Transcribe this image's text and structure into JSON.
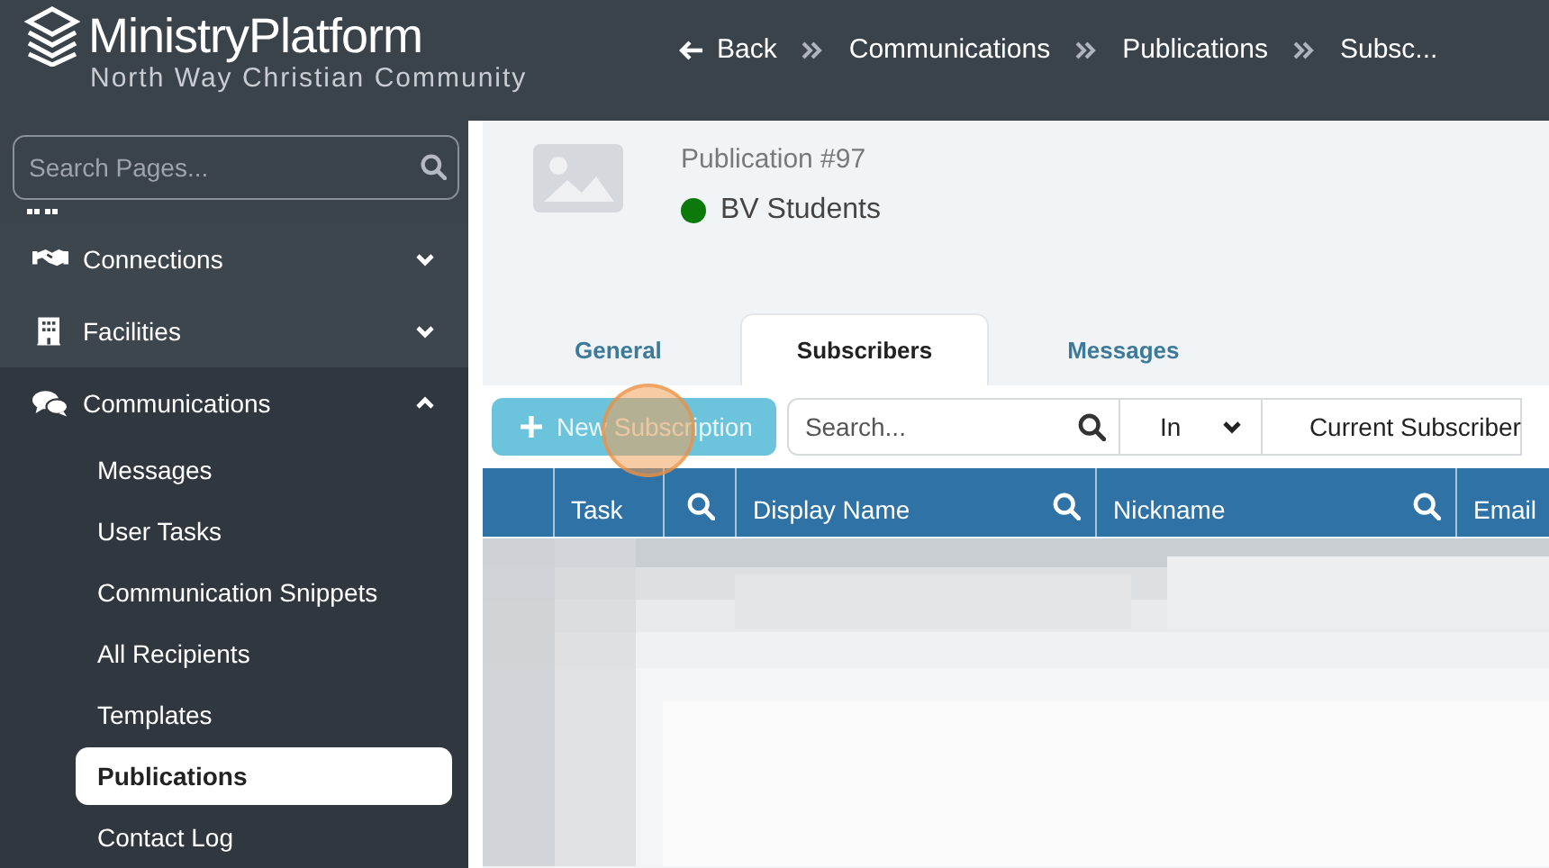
{
  "header": {
    "logo": "MinistryPlatform",
    "subtitle": "North Way Christian Community",
    "breadcrumbs": [
      {
        "label": "Back",
        "kind": "back"
      },
      {
        "label": "Communications",
        "kind": "crumb"
      },
      {
        "label": "Publications",
        "kind": "crumb"
      },
      {
        "label": "Subsc...",
        "kind": "crumb"
      }
    ]
  },
  "sidebar": {
    "search": {
      "placeholder": "Search Pages..."
    },
    "nav": [
      {
        "label": "Connections",
        "expanded": false
      },
      {
        "label": "Facilities",
        "expanded": false
      },
      {
        "label": "Communications",
        "expanded": true,
        "children": [
          {
            "label": "Messages",
            "selected": false
          },
          {
            "label": "User Tasks",
            "selected": false
          },
          {
            "label": "Communication Snippets",
            "selected": false
          },
          {
            "label": "All Recipients",
            "selected": false
          },
          {
            "label": "Templates",
            "selected": false
          },
          {
            "label": "Publications",
            "selected": true
          },
          {
            "label": "Contact Log",
            "selected": false
          }
        ]
      }
    ]
  },
  "record": {
    "label": "Publication #97",
    "name": "BV Students",
    "color": "#0b7a0b"
  },
  "tabs": [
    {
      "label": "General",
      "selected": false
    },
    {
      "label": "Subscribers",
      "selected": true
    },
    {
      "label": "Messages",
      "selected": false
    }
  ],
  "toolbar": {
    "new_button": "New Subscription",
    "search": {
      "placeholder": "Search..."
    },
    "operator": "In",
    "filter": "Current Subscriber"
  },
  "table": {
    "columns": [
      {
        "kind": "blank"
      },
      {
        "kind": "text",
        "label": "Task"
      },
      {
        "kind": "search"
      },
      {
        "kind": "text",
        "label": "Display Name",
        "searchable": true
      },
      {
        "kind": "text",
        "label": "Nickname",
        "searchable": true
      },
      {
        "kind": "text",
        "label": "Email"
      }
    ]
  }
}
